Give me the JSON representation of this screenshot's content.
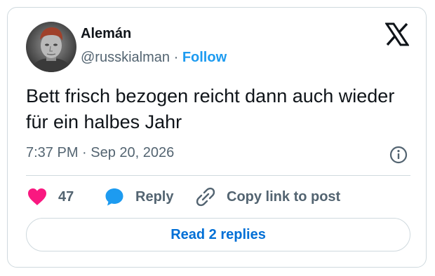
{
  "author": {
    "name": "Alemán",
    "handle": "@russkialman",
    "separator": "·",
    "follow_label": "Follow",
    "avatar": "avatar-photo"
  },
  "tweet": {
    "text": "Bett frisch bezogen reicht dann auch wieder für ein halbes Jahr",
    "timestamp": "7:37 PM · Sep 20, 2026"
  },
  "actions": {
    "like_count": "47",
    "reply_label": "Reply",
    "copy_link_label": "Copy link to post"
  },
  "footer": {
    "read_replies_label": "Read 2 replies"
  },
  "icons": {
    "logo": "x-logo-icon",
    "info": "info-icon",
    "like": "heart-icon",
    "reply": "speech-bubble-icon",
    "copy": "link-icon"
  },
  "colors": {
    "accent": "#1d9bf0",
    "like": "#f91880",
    "reply_link": "#006fd6",
    "secondary_text": "#536471",
    "border": "#cfd9de"
  }
}
